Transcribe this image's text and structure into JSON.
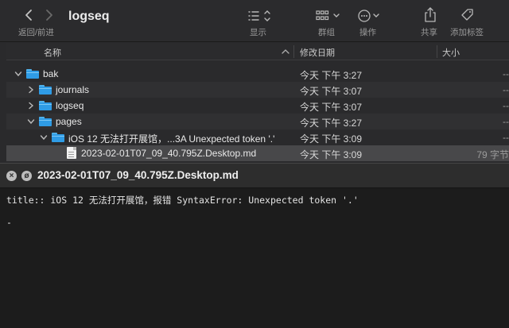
{
  "finder": {
    "title": "logseq",
    "toolbar": {
      "back_forward_label": "返回/前进",
      "view_label": "显示",
      "group_label": "群组",
      "action_label": "操作",
      "share_label": "共享",
      "tags_label": "添加标签"
    },
    "columns": {
      "name": "名称",
      "modified": "修改日期",
      "size": "大小"
    },
    "rows": [
      {
        "name": "bak",
        "date": "今天 下午 3:27",
        "size": "--",
        "kind": "folder",
        "expanded": true,
        "depth": 0
      },
      {
        "name": "journals",
        "date": "今天 下午 3:07",
        "size": "--",
        "kind": "folder",
        "expanded": false,
        "depth": 1
      },
      {
        "name": "logseq",
        "date": "今天 下午 3:07",
        "size": "--",
        "kind": "folder",
        "expanded": false,
        "depth": 1
      },
      {
        "name": "pages",
        "date": "今天 下午 3:27",
        "size": "--",
        "kind": "folder",
        "expanded": true,
        "depth": 1
      },
      {
        "name": "iOS 12 无法打开展馆，...3A Unexpected token '.'",
        "date": "今天 下午 3:09",
        "size": "--",
        "kind": "folder",
        "expanded": true,
        "depth": 2
      },
      {
        "name": "2023-02-01T07_09_40.795Z.Desktop.md",
        "date": "今天 下午 3:09",
        "size": "79 字节",
        "kind": "file",
        "depth": 3,
        "selected": true
      }
    ]
  },
  "editor": {
    "title": "2023-02-01T07_09_40.795Z.Desktop.md",
    "line1": "title:: iOS 12 无法打开展馆，报错 SyntaxError: Unexpected token '.'",
    "cursor_line": "-"
  },
  "colors": {
    "folder_blue": "#2f9ce6",
    "selection": "#48484a",
    "window_bg": "#2a2a2c",
    "editor_bg": "#1c1c1c"
  },
  "icons": {
    "back": "chevron-left-icon",
    "forward": "chevron-right-icon",
    "view": "list-view-icon",
    "group": "grid-group-icon",
    "action": "ellipsis-circle-icon",
    "share": "share-icon",
    "tag": "tag-icon",
    "folder": "folder-icon",
    "file": "document-icon",
    "close": "close-icon",
    "minimize": "minimize-icon"
  }
}
